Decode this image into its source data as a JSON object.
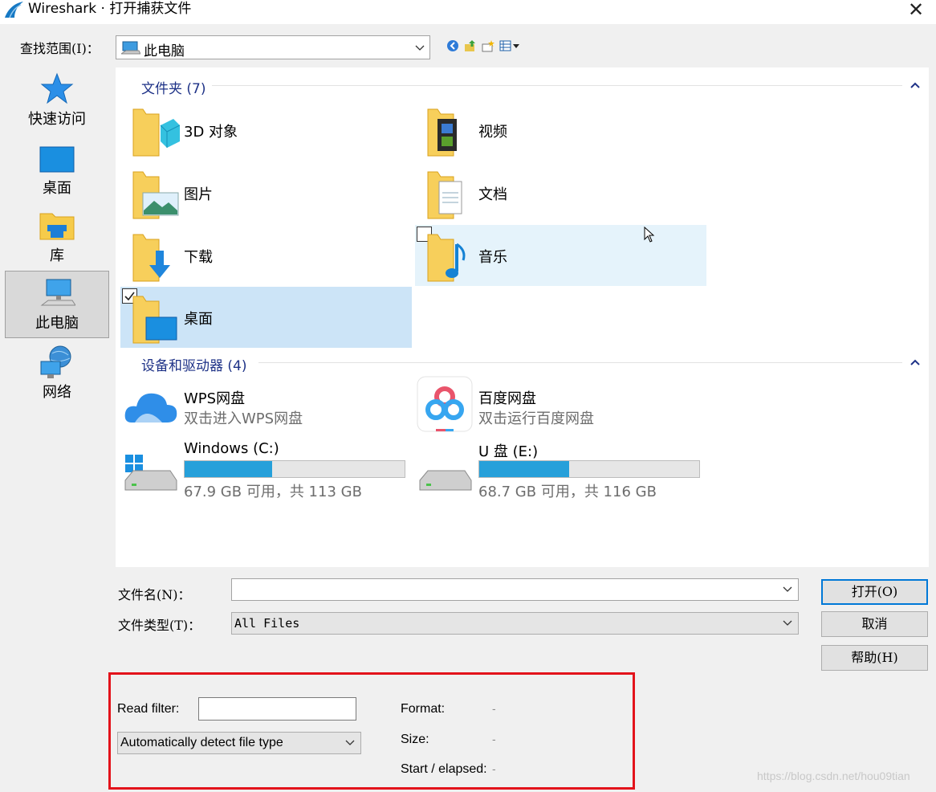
{
  "window": {
    "title": "Wireshark · 打开捕获文件",
    "close_glyph": "✕"
  },
  "lookin": {
    "label": "查找范围(I)：",
    "value": "此电脑"
  },
  "sidebar": {
    "items": [
      {
        "label": "快速访问",
        "icon": "star-icon"
      },
      {
        "label": "桌面",
        "icon": "desktop-icon"
      },
      {
        "label": "库",
        "icon": "library-icon"
      },
      {
        "label": "此电脑",
        "icon": "pc-icon",
        "active": true
      },
      {
        "label": "网络",
        "icon": "network-icon"
      }
    ]
  },
  "folders": {
    "header": "文件夹 (7)",
    "items": [
      {
        "name": "3D 对象",
        "icon": "3d-objects-folder-icon"
      },
      {
        "name": "视频",
        "icon": "videos-folder-icon"
      },
      {
        "name": "图片",
        "icon": "pictures-folder-icon"
      },
      {
        "name": "文档",
        "icon": "documents-folder-icon"
      },
      {
        "name": "下载",
        "icon": "downloads-folder-icon"
      },
      {
        "name": "音乐",
        "icon": "music-folder-icon",
        "state": "hover"
      },
      {
        "name": "桌面",
        "icon": "desktop-folder-icon",
        "state": "selected"
      }
    ]
  },
  "devices": {
    "header": "设备和驱动器 (4)",
    "items": [
      {
        "name": "WPS网盘",
        "sub": "双击进入WPS网盘",
        "icon": "wps-cloud-icon"
      },
      {
        "name": "百度网盘",
        "sub": "双击运行百度网盘",
        "icon": "baidu-netdisk-icon"
      },
      {
        "name": "Windows (C:)",
        "sub": "67.9 GB 可用，共 113 GB",
        "icon": "windows-drive-icon",
        "used_fraction": 0.399
      },
      {
        "name": "U 盘 (E:)",
        "sub": "68.7 GB 可用，共 116 GB",
        "icon": "usb-drive-icon",
        "used_fraction": 0.408
      }
    ]
  },
  "filename": {
    "label": "文件名(N)：",
    "value": ""
  },
  "filetype": {
    "label": "文件类型(T)：",
    "value": "All Files"
  },
  "buttons": {
    "open": "打开(O)",
    "cancel": "取消",
    "help": "帮助(H)"
  },
  "readfilter": {
    "label": "Read filter:",
    "value": "",
    "detect": "Automatically detect file type",
    "format_label": "Format:",
    "format_value": "-",
    "size_label": "Size:",
    "size_value": "-",
    "start_label": "Start / elapsed:",
    "start_value": "-"
  },
  "watermark": "https://blog.csdn.net/hou09tian",
  "colors": {
    "accent": "#0078d7",
    "selection": "#cce4f7",
    "hover": "#e5f3fb",
    "highlight_frame": "#e3131b",
    "meter": "#26a0da"
  }
}
